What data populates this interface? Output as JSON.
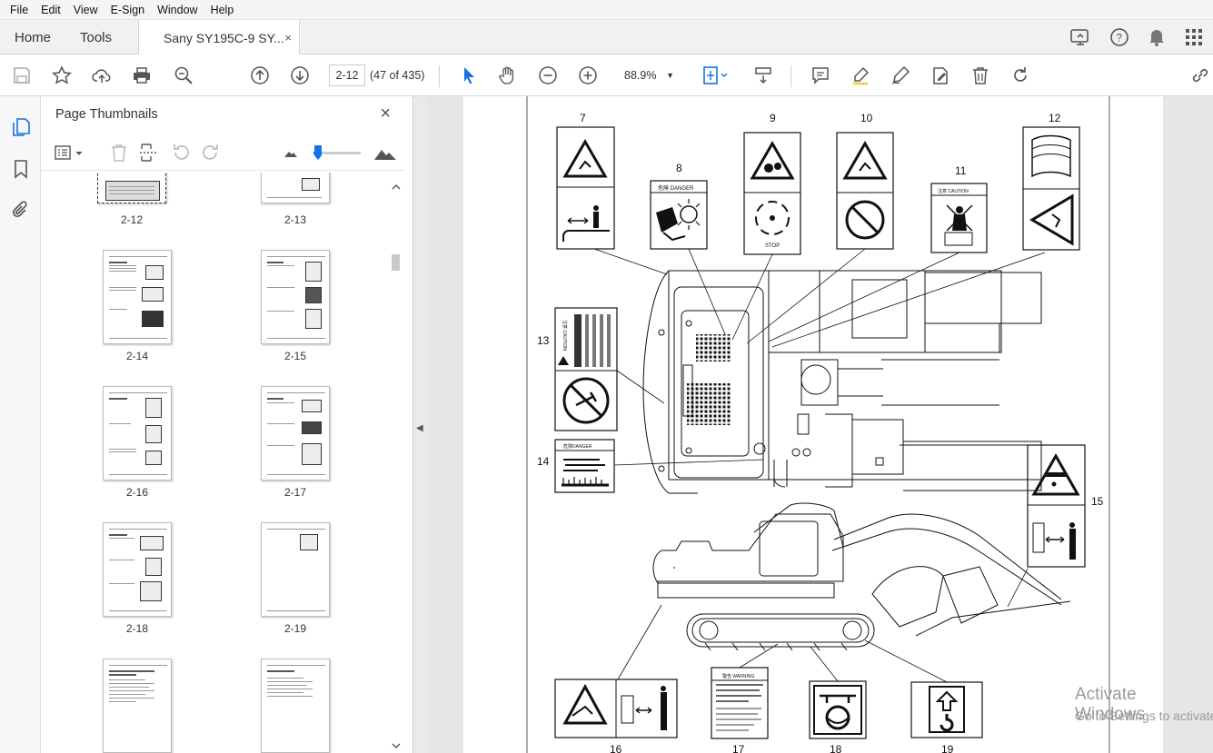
{
  "menu": {
    "items": [
      "File",
      "Edit",
      "View",
      "E-Sign",
      "Window",
      "Help"
    ]
  },
  "tabs": {
    "home": "Home",
    "tools": "Tools",
    "document": "Sany SY195C-9 SY...",
    "document_close": "×"
  },
  "toolbar": {
    "page_current": "2-12",
    "page_count": "(47 of 435)",
    "zoom": "88.9%"
  },
  "thumbnails_panel": {
    "title": "Page Thumbnails",
    "close": "×",
    "pages": [
      {
        "label": "2-12",
        "selected": true
      },
      {
        "label": "2-13"
      },
      {
        "label": "2-14"
      },
      {
        "label": "2-15"
      },
      {
        "label": "2-16"
      },
      {
        "label": "2-17"
      },
      {
        "label": "2-18"
      },
      {
        "label": "2-19"
      },
      {
        "label": "",
        "partial": true
      },
      {
        "label": "",
        "partial": true
      }
    ]
  },
  "document": {
    "callouts": [
      "7",
      "8",
      "9",
      "10",
      "11",
      "12",
      "13",
      "14",
      "15",
      "16",
      "17",
      "18",
      "19"
    ],
    "labels": {
      "danger_8": "危険 DANGER",
      "stop": "STOP",
      "caution_11": "注意 CAUTION",
      "caution_13": "注意 CAUTION",
      "danger_14": "危険DANGER",
      "warning_17": "警告 WARNING",
      "warning_17_cn": "缓慢拧松泄压阀一圈。如果阀松开太多，油脂压力高时可能会弹出。",
      "warning_17_en": "To release pressure, loosen only one turn. If the valve is loosened too much, grease under high pressure may squirt out."
    }
  },
  "watermark": {
    "line1": "Activate Windows",
    "line2": "Go to Settings to activate Windows."
  },
  "colors": {
    "accent": "#1473e6",
    "toolbar_bg": "#f1f1f1",
    "doc_bg": "#e6e6e6"
  }
}
